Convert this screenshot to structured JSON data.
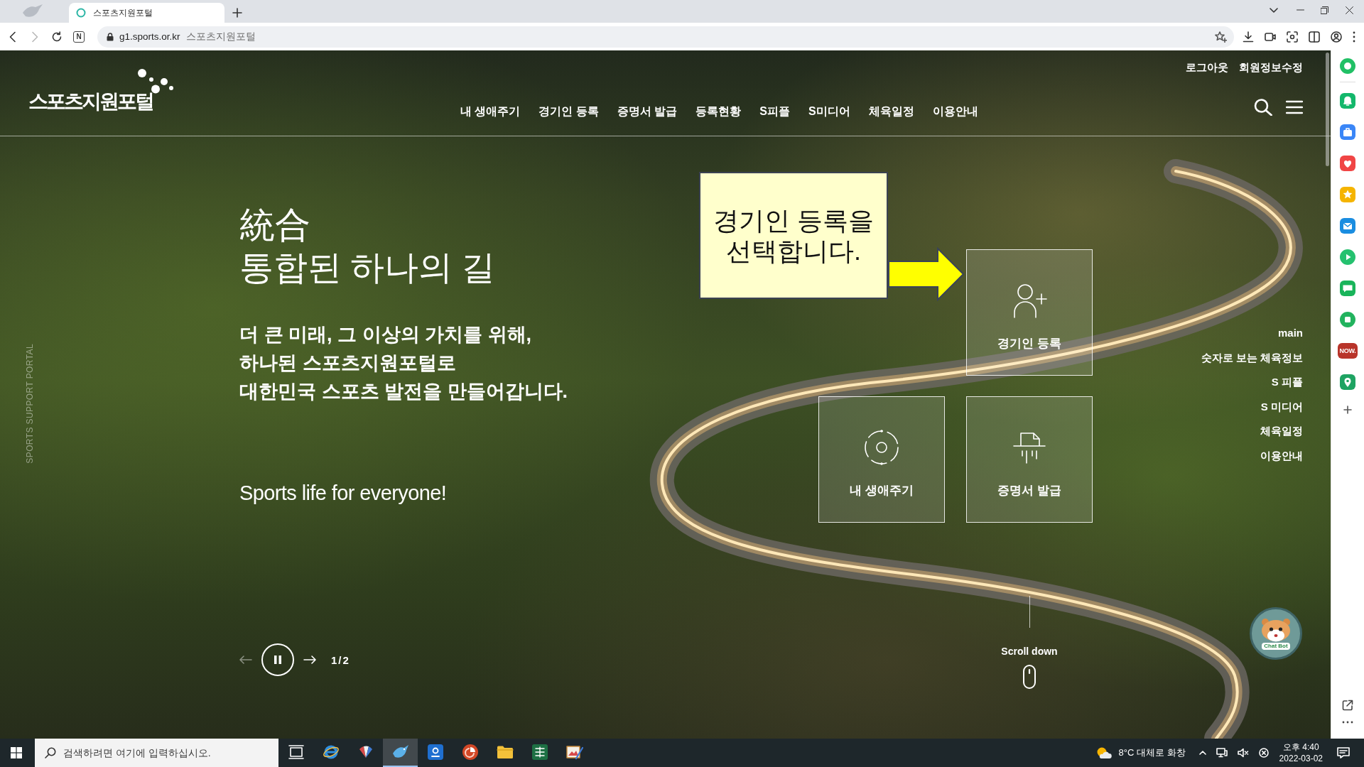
{
  "browser": {
    "tabs": [
      {
        "title": "스포츠지원포털",
        "selected": true
      }
    ],
    "forward_disabled": true,
    "site_button": "N",
    "address": {
      "url": "g1.sports.or.kr",
      "page_title": "스포츠지원포털"
    }
  },
  "site": {
    "logo": "스포츠지원포털",
    "top_links": [
      "로그아웃",
      "회원정보수정"
    ],
    "nav": [
      "내 생애주기",
      "경기인 등록",
      "증명서 발급",
      "등록현황",
      "S피플",
      "S미디어",
      "체육일정",
      "이용안내"
    ],
    "side_label": "SPORTS SUPPORT PORTAL",
    "hero": {
      "title_hanja": "統合",
      "title": "통합된 하나의 길",
      "description": [
        "더 큰 미래, 그 이상의 가치를 위해,",
        "하나된 스포츠지원포털로",
        "대한민국 스포츠 발전을 만들어갑니다."
      ],
      "slogan": "Sports life for everyone!",
      "slider": {
        "prev_disabled": true,
        "playing": true,
        "counter": "1/2"
      }
    },
    "quick_menu": [
      {
        "kind": "register",
        "label": "경기인 등록"
      },
      {
        "kind": "lifecycle",
        "label": "내 생애주기"
      },
      {
        "kind": "certificate",
        "label": "증명서 발급"
      }
    ],
    "side_menu": [
      "main",
      "숫자로 보는 체육정보",
      "S 피플",
      "S 미디어",
      "체육일정",
      "이용안내"
    ],
    "scroll_hint": "Scroll down",
    "chatbot": {
      "label": "Chat Bot"
    }
  },
  "annotation": {
    "text": "경기인 등록을 선택합니다."
  },
  "side_panel": {
    "badge": "NOW."
  },
  "taskbar": {
    "search": {
      "placeholder": "검색하려면 여기에 입력하십시오."
    },
    "apps": [
      {
        "kind": "task-view",
        "selected": false
      },
      {
        "kind": "orbit",
        "selected": false
      },
      {
        "kind": "fan",
        "selected": false
      },
      {
        "kind": "bird",
        "selected": true
      },
      {
        "kind": "tile",
        "selected": false
      },
      {
        "kind": "pie",
        "selected": false
      },
      {
        "kind": "folder",
        "selected": false
      },
      {
        "kind": "grid",
        "selected": false
      },
      {
        "kind": "picture",
        "selected": false
      }
    ],
    "weather": "8°C 대체로 화창",
    "time": "오후 4:40",
    "date": "2022-03-02"
  }
}
